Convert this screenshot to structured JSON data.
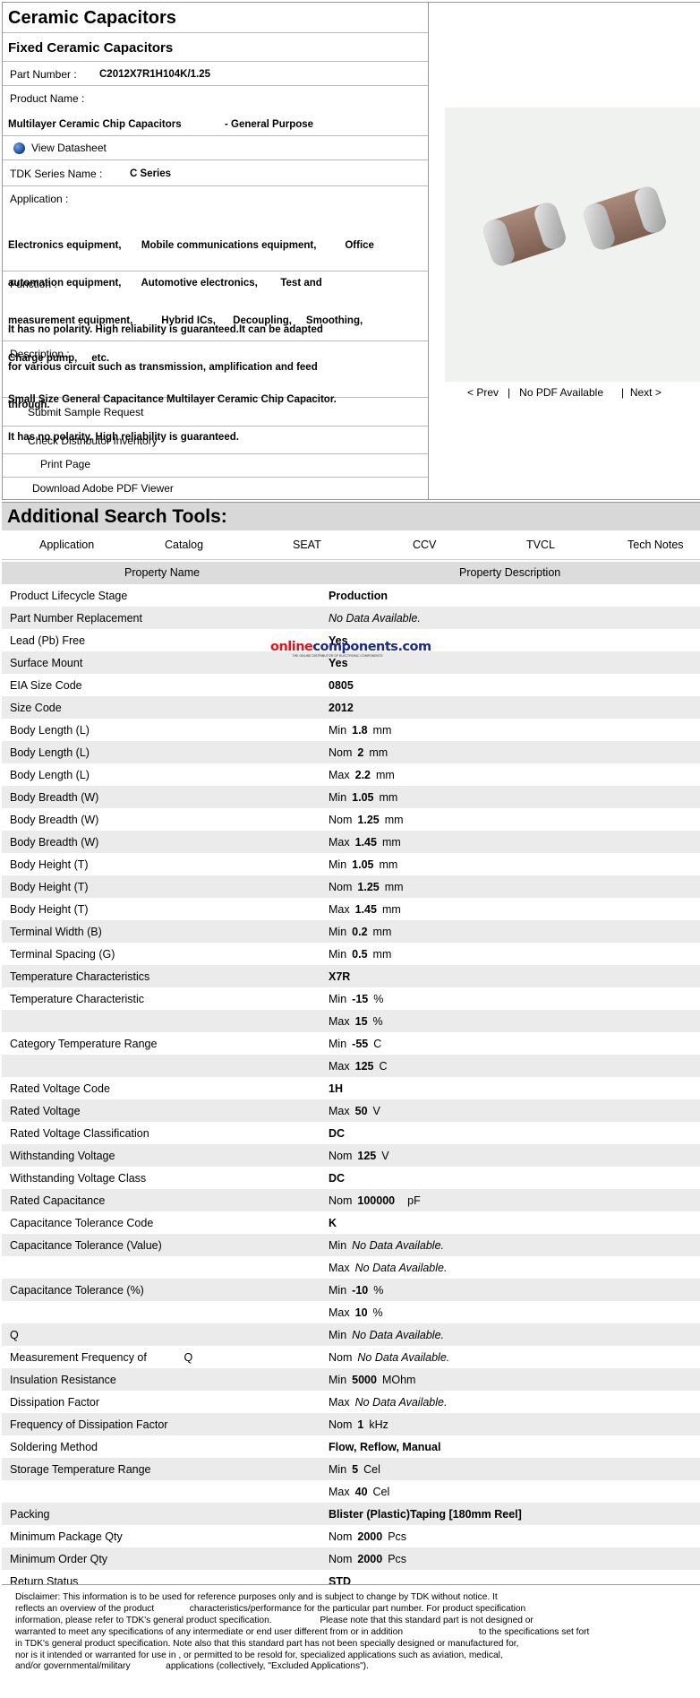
{
  "header": {
    "title": "Ceramic Capacitors",
    "subtitle": "Fixed Ceramic Capacitors",
    "part_number_label": "Part Number :",
    "part_number": "C2012X7R1H104K/1.25",
    "product_name_label": "Product Name :",
    "product_name": "Multilayer Ceramic Chip Capacitors",
    "product_name_suffix": "- General Purpose",
    "datasheet_link": "View Datasheet",
    "series_label": "TDK Series Name :",
    "series": "C Series",
    "application_label": "Application :",
    "application_lines": [
      "Electronics equipment,       Mobile communications equipment,          Office",
      "automation equipment,       Automotive electronics,        Test and",
      "measurement equipment,          Hybrid ICs,      Decoupling,     Smoothing,",
      "Charge pump,     etc."
    ],
    "function_label": "Function :",
    "function_lines": [
      "It has no polarity. High reliability is guaranteed.It can be adapted",
      "for various circuit such as transmission, amplification and feed",
      "through."
    ],
    "description_label": "Description :",
    "description_lines": [
      "Small Size General Capacitance Multilayer Ceramic Chip Capacitor.",
      "It has no polarity. High reliability is guaranteed."
    ],
    "actions": {
      "submit_sample": "Submit Sample Request",
      "check_inventory": "Check Distributor Inventory",
      "print_page": "Print Page",
      "download_pdf_viewer": "Download Adobe PDF Viewer"
    }
  },
  "image_nav": {
    "prev": "< Prev",
    "sep1": "|",
    "no_pdf": "No PDF Available",
    "sep2": "|",
    "next": "Next >"
  },
  "tools": {
    "title": "Additional Search Tools:",
    "links": [
      "Application",
      "Catalog",
      "SEAT",
      "CCV",
      "TVCL",
      "Tech Notes"
    ]
  },
  "table": {
    "col_name": "Property Name",
    "col_desc": "Property Description",
    "rows": [
      {
        "name": "Product Lifecycle Stage",
        "q": "",
        "v": "Production",
        "u": ""
      },
      {
        "name": "Part Number Replacement",
        "q": "",
        "v": "No Data Available.",
        "u": "",
        "na": true
      },
      {
        "name": "Lead (Pb) Free",
        "q": "",
        "v": "Yes",
        "u": ""
      },
      {
        "name": "Surface Mount",
        "q": "",
        "v": "Yes",
        "u": ""
      },
      {
        "name": "EIA Size Code",
        "q": "",
        "v": "0805",
        "u": ""
      },
      {
        "name": "Size Code",
        "q": "",
        "v": "2012",
        "u": ""
      },
      {
        "name": "Body Length (L)",
        "q": "Min",
        "v": "1.8",
        "u": "mm"
      },
      {
        "name": "Body Length (L)",
        "q": "Nom",
        "v": "2",
        "u": "mm"
      },
      {
        "name": "Body Length (L)",
        "q": "Max",
        "v": "2.2",
        "u": "mm"
      },
      {
        "name": "Body Breadth (W)",
        "q": "Min",
        "v": "1.05",
        "u": "mm"
      },
      {
        "name": "Body Breadth (W)",
        "q": "Nom",
        "v": "1.25",
        "u": "mm"
      },
      {
        "name": "Body Breadth (W)",
        "q": "Max",
        "v": "1.45",
        "u": "mm"
      },
      {
        "name": "Body Height (T)",
        "q": "Min",
        "v": "1.05",
        "u": "mm"
      },
      {
        "name": "Body Height (T)",
        "q": "Nom",
        "v": "1.25",
        "u": "mm"
      },
      {
        "name": "Body Height (T)",
        "q": "Max",
        "v": "1.45",
        "u": "mm"
      },
      {
        "name": "Terminal Width (B)",
        "q": "Min",
        "v": "0.2",
        "u": "mm"
      },
      {
        "name": "Terminal Spacing (G)",
        "q": "Min",
        "v": "0.5",
        "u": "mm"
      },
      {
        "name": "Temperature Characteristics",
        "q": "",
        "v": "X7R",
        "u": ""
      },
      {
        "name": "Temperature Characteristic",
        "q": "Min",
        "v": "-15",
        "u": "%"
      },
      {
        "name": "",
        "q": "Max",
        "v": "15",
        "u": "%"
      },
      {
        "name": "Category Temperature Range",
        "q": "Min",
        "v": "-55",
        "u": "C"
      },
      {
        "name": "",
        "q": "Max",
        "v": "125",
        "u": "C"
      },
      {
        "name": "Rated Voltage Code",
        "q": "",
        "v": "1H",
        "u": ""
      },
      {
        "name": "Rated Voltage",
        "q": "Max",
        "v": "50",
        "u": "V"
      },
      {
        "name": "Rated Voltage Classification",
        "q": "",
        "v": "DC",
        "u": ""
      },
      {
        "name": "Withstanding Voltage",
        "q": "Nom",
        "v": "125",
        "u": "V"
      },
      {
        "name": "Withstanding Voltage Class",
        "q": "",
        "v": "DC",
        "u": ""
      },
      {
        "name": "Rated Capacitance",
        "q": "Nom",
        "v": "100000",
        "u": "pF"
      },
      {
        "name": "Capacitance Tolerance Code",
        "q": "",
        "v": "K",
        "u": ""
      },
      {
        "name": "Capacitance Tolerance (Value)",
        "q": "Min",
        "v": "No Data Available.",
        "u": "",
        "na": true
      },
      {
        "name": "",
        "q": "Max",
        "v": "No Data Available.",
        "u": "",
        "na": true
      },
      {
        "name": "Capacitance Tolerance (%)",
        "q": "Min",
        "v": "-10",
        "u": "%"
      },
      {
        "name": "",
        "q": "Max",
        "v": "10",
        "u": "%"
      },
      {
        "name": "Q",
        "q": "Min",
        "v": "No Data Available.",
        "u": "",
        "na": true
      },
      {
        "name": "Measurement Frequency of            Q",
        "q": "Nom",
        "v": "No Data Available.",
        "u": "",
        "na": true
      },
      {
        "name": "Insulation Resistance",
        "q": "Min",
        "v": "5000",
        "u": "MOhm"
      },
      {
        "name": "Dissipation Factor",
        "q": "Max",
        "v": "No Data Available.",
        "u": "",
        "na": true
      },
      {
        "name": "Frequency of Dissipation Factor",
        "q": "Nom",
        "v": "1",
        "u": "kHz"
      },
      {
        "name": "Soldering Method",
        "q": "",
        "v": "Flow, Reflow, Manual",
        "u": ""
      },
      {
        "name": "Storage Temperature Range",
        "q": "Min",
        "v": "5",
        "u": "Cel"
      },
      {
        "name": "",
        "q": "Max",
        "v": "40",
        "u": "Cel"
      },
      {
        "name": "Packing",
        "q": "",
        "v": "Blister (Plastic)Taping [180mm Reel]",
        "u": ""
      },
      {
        "name": "Minimum Package Qty",
        "q": "Nom",
        "v": "2000",
        "u": "Pcs"
      },
      {
        "name": "Minimum Order Qty",
        "q": "Nom",
        "v": "2000",
        "u": "Pcs"
      },
      {
        "name": "Return Status",
        "q": "",
        "v": "STD",
        "u": ""
      }
    ]
  },
  "watermark": {
    "brand_a": "online",
    "brand_b": "components.com",
    "tagline": "THE ONLINE DISTRIBUTOR OF ELECTRONIC COMPONENTS",
    "color_a": "#e8131b",
    "color_b": "#1a2a8c"
  },
  "disclaimer": "Disclaimer: This information is to be used for reference purposes only and is subject to change by TDK without notice. It\nreflects an overview of the product              characteristics/performance for the particular part number. For product specification\ninformation, please refer to TDK's general product specification.                   Please note that this standard part is not designed or\nwarranted to meet any specifications of any intermediate or end user different from or in addition                              to the specifications set fort\nin TDK's general product specification. Note also that this standard part has not been specially designed or manufactured for,\nnor is it intended or warranted for use in , or permitted to be resold for, specialized applications such as aviation, medical,\nand/or governmental/military              applications (collectively, \"Excluded Applications\")."
}
